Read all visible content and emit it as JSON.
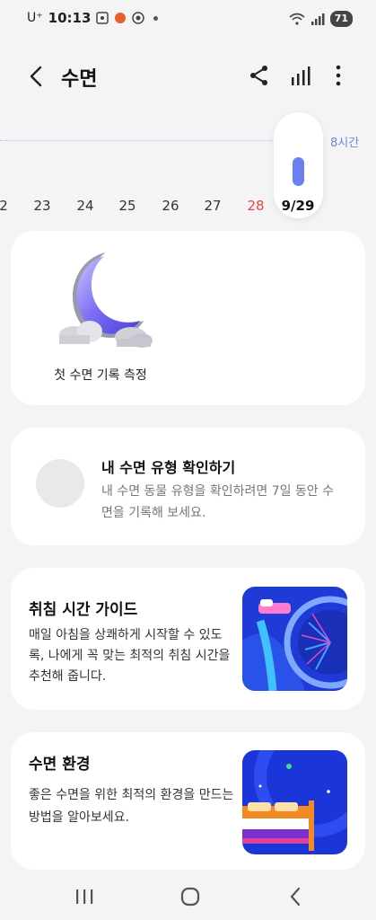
{
  "status_bar": {
    "carrier": "U⁺",
    "time": "10:13",
    "battery": "71"
  },
  "header": {
    "title": "수면"
  },
  "timeline": {
    "hours_label": "8시간",
    "days": [
      "2",
      "23",
      "24",
      "25",
      "26",
      "27",
      "28"
    ],
    "selected_day": "9/29"
  },
  "first_record": {
    "label": "첫 수면 기록 측정"
  },
  "sleep_type": {
    "title": "내 수면 유형 확인하기",
    "description": "내 수면 동물 유형을 확인하려면 7일 동안 수면을 기록해 보세요."
  },
  "bedtime_guide": {
    "title": "취침 시간 가이드",
    "description": "매일 아침을 상쾌하게 시작할 수 있도록, 나에게 꼭 맞는 최적의 취침 시간을 추천해 줍니다."
  },
  "sleep_environment": {
    "title": "수면 환경",
    "description": "좋은 수면을 위한 최적의 환경을 만드는 방법을 알아보세요."
  },
  "colors": {
    "accent": "#6a7ff0",
    "weekend_red": "#e04848",
    "background": "#f4f4f6"
  }
}
